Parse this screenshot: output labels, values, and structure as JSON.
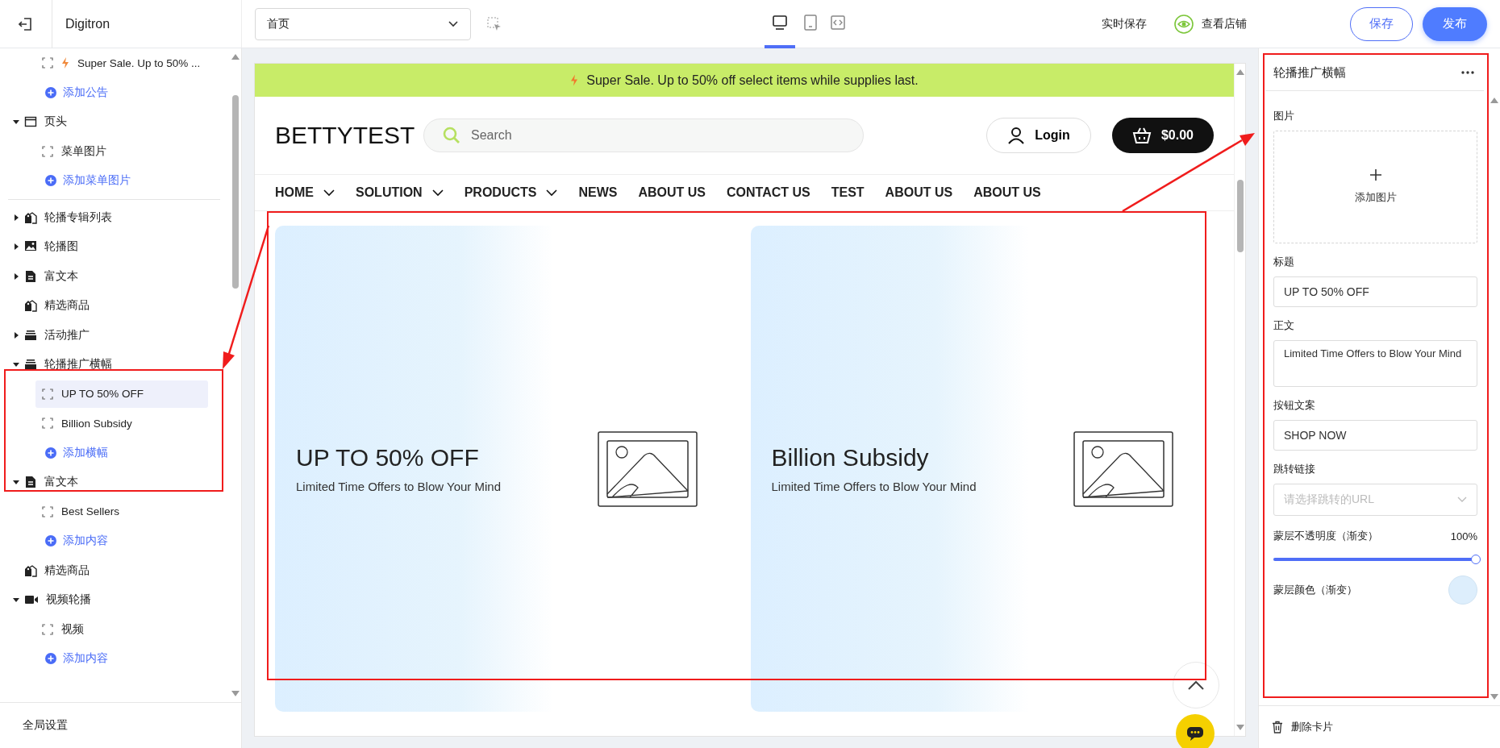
{
  "app": {
    "name": "Digitron"
  },
  "page_select": {
    "value": "首页"
  },
  "device_tabs": [
    {
      "kind": "desktop",
      "selected": true
    },
    {
      "kind": "tablet",
      "selected": false
    },
    {
      "kind": "code",
      "selected": false
    }
  ],
  "autosave": "实时保存",
  "view_store": "查看店铺",
  "actions": {
    "save": "保存",
    "publish": "发布"
  },
  "tree_groups": [
    [
      {
        "children": [
          {
            "label": "Super Sale. Up to 50% ...",
            "kind": "announcement",
            "selected": false
          }
        ],
        "add_label": "添加公告"
      },
      {
        "label": "页头",
        "kind": "header",
        "expanded": true,
        "children": [
          {
            "label": "菜单图片",
            "selected": false
          }
        ],
        "add_label": "添加菜单图片"
      }
    ],
    [
      {
        "label": "轮播专辑列表",
        "kind": "products",
        "expanded": false
      },
      {
        "label": "轮播图",
        "kind": "gallery",
        "expanded": false
      },
      {
        "label": "富文本",
        "kind": "richtext",
        "expanded": false
      },
      {
        "label": "精选商品",
        "kind": "products"
      },
      {
        "label": "活动推广",
        "kind": "promo",
        "expanded": false
      },
      {
        "label": "轮播推广横幅",
        "kind": "promo",
        "expanded": true,
        "children": [
          {
            "label": "UP TO 50% OFF",
            "selected": true
          },
          {
            "label": "Billion Subsidy",
            "selected": false
          }
        ],
        "add_label": "添加横幅"
      },
      {
        "label": "富文本",
        "kind": "richtext",
        "expanded": true,
        "children": [
          {
            "label": "Best Sellers",
            "selected": false
          }
        ],
        "add_label": "添加内容"
      },
      {
        "label": "精选商品",
        "kind": "products"
      },
      {
        "label": "视频轮播",
        "kind": "video",
        "expanded": true,
        "children": [
          {
            "label": "视频",
            "selected": false
          }
        ],
        "add_label": "添加内容"
      }
    ]
  ],
  "global_settings": "全局设置",
  "preview": {
    "announcement": "Super Sale. Up to 50% off select items while supplies last.",
    "logo": "BETTYTEST",
    "search": {
      "placeholder": "Search"
    },
    "login": "Login",
    "cart": "$0.00",
    "nav": [
      {
        "label": "HOME",
        "dropdown": true
      },
      {
        "label": "SOLUTION",
        "dropdown": true
      },
      {
        "label": "PRODUCTS",
        "dropdown": true
      },
      {
        "label": "NEWS",
        "dropdown": false
      },
      {
        "label": "ABOUT US",
        "dropdown": false
      },
      {
        "label": "CONTACT US",
        "dropdown": false
      },
      {
        "label": "TEST",
        "dropdown": false
      },
      {
        "label": "ABOUT US",
        "dropdown": false
      },
      {
        "label": "ABOUT US",
        "dropdown": false
      }
    ],
    "banners": [
      {
        "title": "UP TO 50% OFF",
        "body": "Limited Time Offers to Blow Your Mind"
      },
      {
        "title": "Billion Subsidy",
        "body": "Limited Time Offers to Blow Your Mind"
      }
    ]
  },
  "inspector": {
    "title": "轮播推广横幅",
    "image_label": "图片",
    "add_image": "添加图片",
    "fields": [
      {
        "kind": "text",
        "label": "标题",
        "value": "UP TO 50% OFF"
      },
      {
        "kind": "textarea",
        "label": "正文",
        "value": "Limited Time Offers to Blow Your Mind"
      },
      {
        "kind": "text",
        "label": "按钮文案",
        "value": "SHOP NOW"
      },
      {
        "kind": "select",
        "label": "跳转链接",
        "placeholder": "请选择跳转的URL"
      },
      {
        "kind": "slider",
        "label": "蒙层不透明度（渐变）",
        "reading": "100%",
        "level": 1
      },
      {
        "kind": "color",
        "label": "蒙层颜色（渐变）",
        "color": "#ddeefc"
      }
    ],
    "delete": "删除卡片"
  }
}
